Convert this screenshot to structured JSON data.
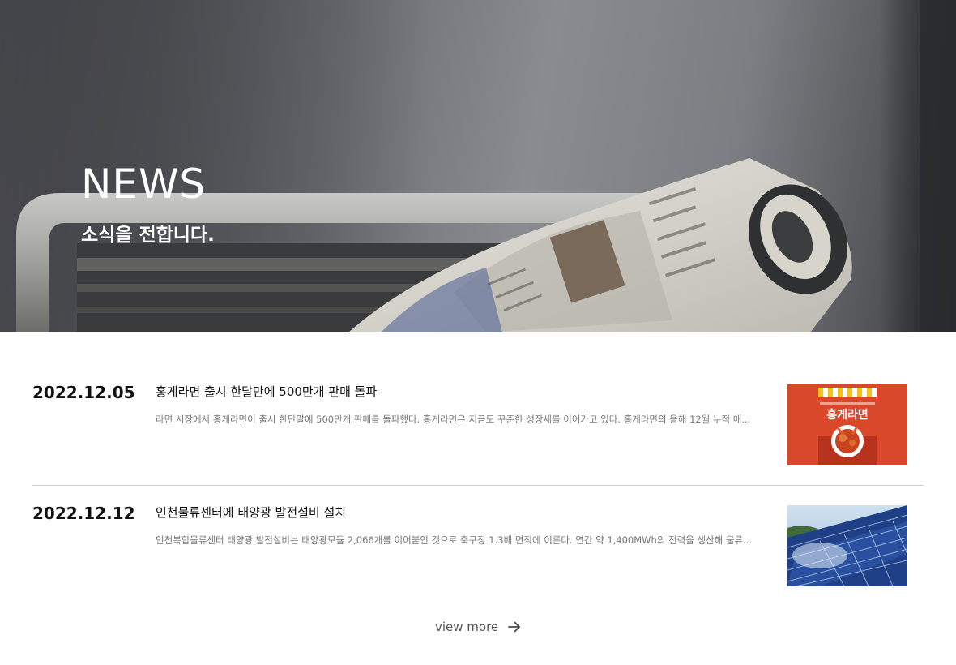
{
  "hero": {
    "title": "NEWS",
    "subtitle": "소식을 전합니다."
  },
  "news": [
    {
      "date": "2022.12.05",
      "title": "홍게라면 출시 한달만에 500만개 판매 돌파",
      "excerpt": "라면 시장에서 홍게라면이 출시 한단말에 500만개 판매를 돌파했다. 홍게라면은 지금도 꾸준한 성장세를 이어가고 있다. 홍게라면의 올해 12월 누적 매...",
      "thumb_label": "홍게라면",
      "thumb_color": "#d9482a"
    },
    {
      "date": "2022.12.12",
      "title": "인천물류센터에 태양광 발전설비 설치",
      "excerpt": "인천복합물류센터 태양광 발전설비는 태양광모듈 2,066개를 이어붙인 것으로 축구장 1.3배 면적에 이른다. 연간 약 1,400MWh의 전력을 생산해 물류...",
      "thumb_color": "#2b4f9a"
    }
  ],
  "view_more": {
    "label": "view more",
    "icon": "arrow-right-icon"
  }
}
